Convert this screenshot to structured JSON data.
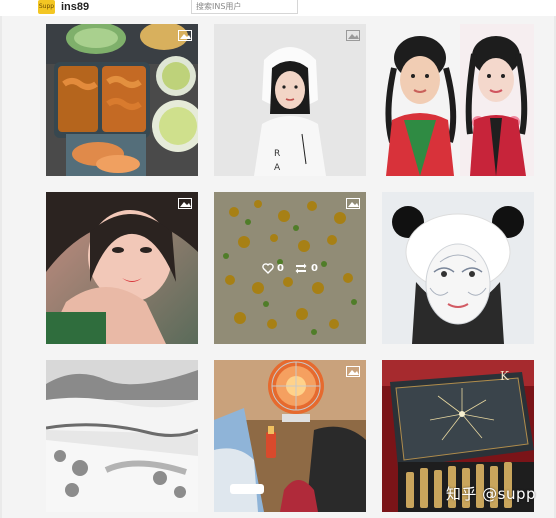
{
  "header": {
    "logo_text": "Supp",
    "brand": "ins89",
    "search_placeholder": "搜索INS用户"
  },
  "grid": {
    "tiles": [
      {
        "name": "photo-food-meal-prep",
        "overlay": null
      },
      {
        "name": "photo-girl-white-hoodie",
        "overlay": null
      },
      {
        "name": "photo-two-girls-pigtails",
        "overlay": null
      },
      {
        "name": "photo-girl-closeup",
        "overlay": null
      },
      {
        "name": "photo-fried-rice",
        "overlay": {
          "likes": "0",
          "reposts": "0"
        }
      },
      {
        "name": "photo-girl-mask-panda-headband",
        "overlay": null
      },
      {
        "name": "photo-snowy-landscape",
        "overlay": null
      },
      {
        "name": "photo-room-heater",
        "overlay": null
      },
      {
        "name": "photo-perfume-gift-box",
        "overlay": null
      }
    ]
  },
  "watermark": "知乎 @supp",
  "colors": {
    "logo_bg": "#f3c623",
    "page_bg": "#f4f4f4"
  },
  "icons": {
    "gallery": "gallery-icon",
    "heart": "heart-icon",
    "repost": "repost-icon"
  }
}
